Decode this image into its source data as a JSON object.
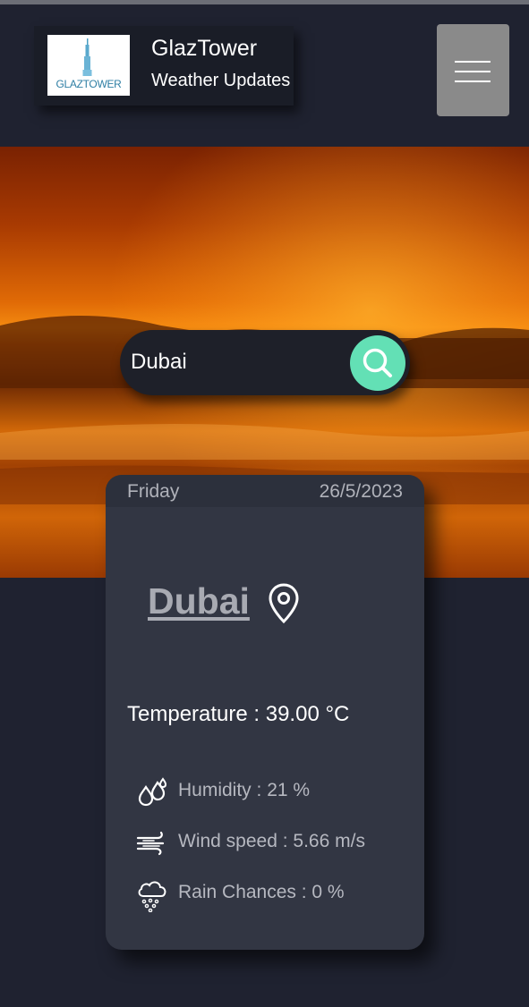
{
  "brand": {
    "logo_text": "GLAZTOWER",
    "title": "GlazTower",
    "subtitle": "Weather Updates"
  },
  "nav": {
    "menu_icon": "hamburger-menu-icon"
  },
  "search": {
    "value": "Dubai",
    "button_icon": "search-icon"
  },
  "weather": {
    "day": "Friday",
    "date": "26/5/2023",
    "city": "Dubai",
    "temperature_label": "Temperature : ",
    "temperature_value": "39.00 °C",
    "humidity_label": "Humidity : ",
    "humidity_value": "21 %",
    "wind_label": "Wind speed : ",
    "wind_value": "5.66 m/s",
    "rain_label": "Rain Chances : ",
    "rain_value": "0 %"
  },
  "colors": {
    "background": "#1f2230",
    "card": "#323643",
    "accent": "#63e0b5",
    "menu_button": "#8a8a8a"
  }
}
